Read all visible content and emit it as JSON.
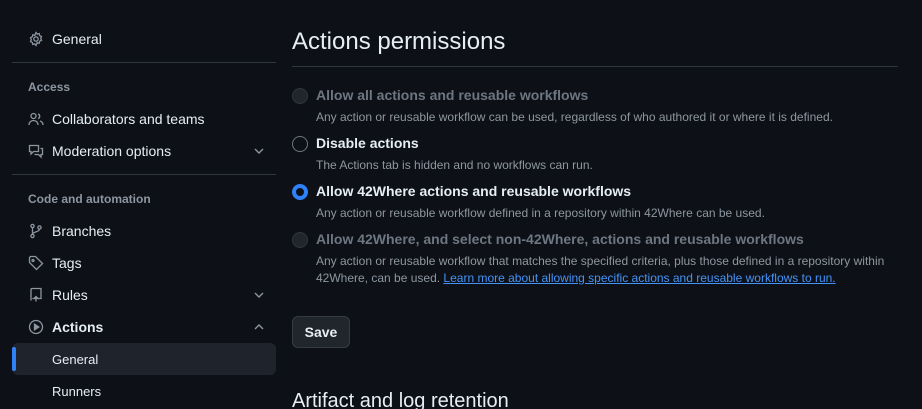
{
  "sidebar": {
    "general_label": "General",
    "access_title": "Access",
    "collaborators_label": "Collaborators and teams",
    "moderation_label": "Moderation options",
    "code_title": "Code and automation",
    "branches_label": "Branches",
    "tags_label": "Tags",
    "rules_label": "Rules",
    "actions_label": "Actions",
    "actions_general_label": "General",
    "actions_runners_label": "Runners"
  },
  "main": {
    "title": "Actions permissions",
    "options": [
      {
        "label": "Allow all actions and reusable workflows",
        "description": "Any action or reusable workflow can be used, regardless of who authored it or where it is defined.",
        "state": "disabled"
      },
      {
        "label": "Disable actions",
        "description": "The Actions tab is hidden and no workflows can run.",
        "state": "unchecked"
      },
      {
        "label": "Allow 42Where actions and reusable workflows",
        "description": "Any action or reusable workflow defined in a repository within 42Where can be used.",
        "state": "checked"
      },
      {
        "label": "Allow 42Where, and select non-42Where, actions and reusable workflows",
        "description": "Any action or reusable workflow that matches the specified criteria, plus those defined in a repository within 42Where, can be used. ",
        "link_text": "Learn more about allowing specific actions and reusable workflows to run.",
        "state": "disabled"
      }
    ],
    "save_label": "Save",
    "next_section_title": "Artifact and log retention"
  },
  "colors": {
    "background": "#0d1117",
    "accent": "#2f81f7",
    "link": "#4493f8",
    "muted": "#8d96a0"
  }
}
